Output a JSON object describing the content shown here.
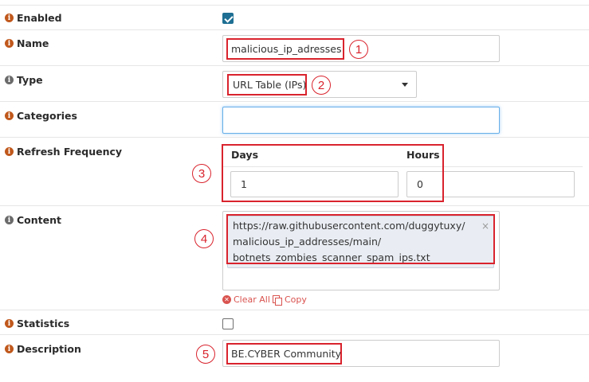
{
  "form": {
    "enabled": {
      "label": "Enabled",
      "checked": true
    },
    "name": {
      "label": "Name",
      "value": "malicious_ip_adresses",
      "marker": "1"
    },
    "type": {
      "label": "Type",
      "value": "URL Table (IPs)",
      "marker": "2"
    },
    "categories": {
      "label": "Categories",
      "value": ""
    },
    "refresh": {
      "label": "Refresh Frequency",
      "days_label": "Days",
      "hours_label": "Hours",
      "days_value": "1",
      "hours_value": "0",
      "marker": "3"
    },
    "content": {
      "label": "Content",
      "lines": [
        "https://raw.githubusercontent.com/duggytuxy/",
        "malicious_ip_addresses/main/",
        "botnets_zombies_scanner_spam_ips.txt"
      ],
      "remove_glyph": "×",
      "marker": "4",
      "clear_all": "Clear All",
      "copy": "Copy"
    },
    "statistics": {
      "label": "Statistics",
      "checked": false
    },
    "description": {
      "label": "Description",
      "value": "BE.CYBER Community",
      "marker": "5"
    }
  },
  "colors": {
    "annotation_red": "#d9232d",
    "info_orange": "#c0581c",
    "checkbox_blue": "#1e6f93"
  }
}
